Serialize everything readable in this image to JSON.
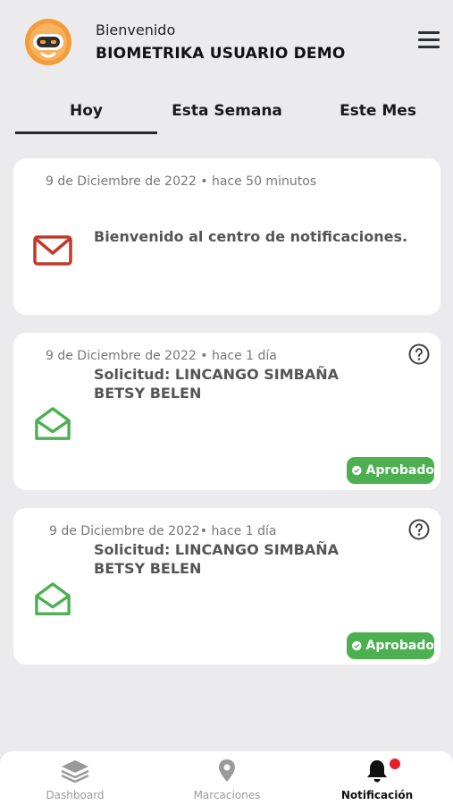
{
  "header": {
    "greeting": "Bienvenido",
    "user_name": "BIOMETRIKA USUARIO DEMO"
  },
  "tabs": [
    {
      "label": "Hoy",
      "active": true
    },
    {
      "label": "Esta Semana",
      "active": false
    },
    {
      "label": "Este Mes",
      "active": false
    }
  ],
  "notifications": [
    {
      "date": "9 de Diciembre de 2022 • hace 50 minutos",
      "message": "Bienvenido al centro de notificaciones."
    },
    {
      "date": "9 de Diciembre de 2022 • hace 1 día",
      "title": "Solicitud: LINCANGO SIMBAÑA BETSY BELEN",
      "status": "Aprobado"
    },
    {
      "date": "9 de Diciembre de 2022• hace 1 día",
      "title": "Solicitud: LINCANGO SIMBAÑA BETSY BELEN",
      "status": "Aprobado"
    }
  ],
  "bottom_nav": [
    {
      "label": "Dashboard",
      "icon": "layers-icon",
      "active": false
    },
    {
      "label": "Marcaciones",
      "icon": "location-pin-icon",
      "active": false
    },
    {
      "label": "Notificación",
      "icon": "bell-icon",
      "active": true
    }
  ],
  "colors": {
    "background": "#ebebed",
    "approved": "#4caf50",
    "unread_envelope": "#c0392b",
    "read_envelope": "#4caf50",
    "notification_dot": "#e5202b",
    "avatar": "#f39c3a"
  }
}
